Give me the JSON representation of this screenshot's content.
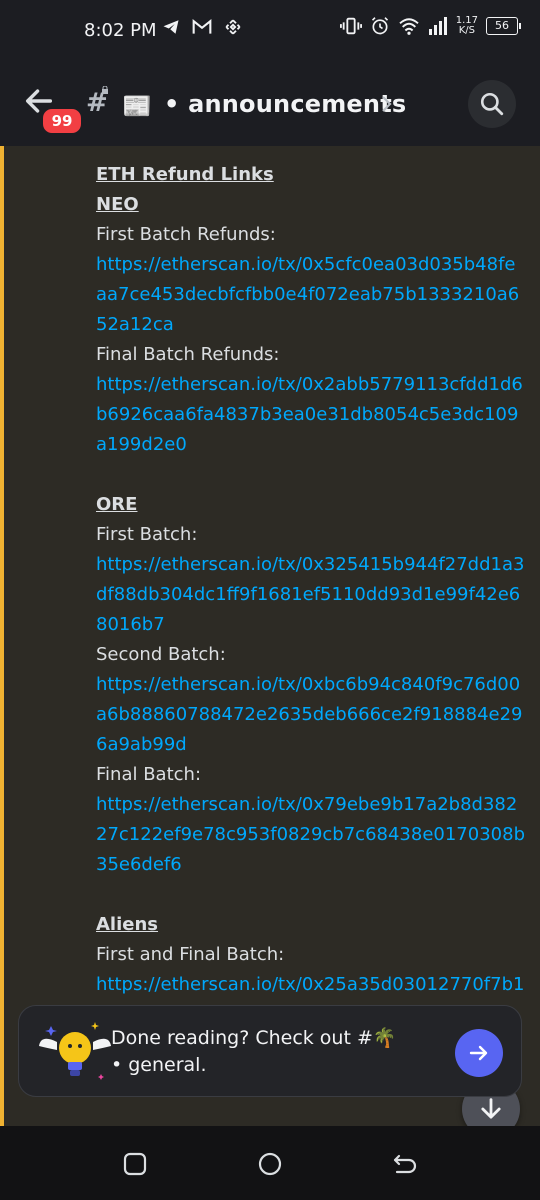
{
  "status_bar": {
    "time": "8:02 PM",
    "net_speed_value": "1.17",
    "net_speed_unit": "K/S",
    "battery": "56"
  },
  "header": {
    "unread_badge": "99",
    "channel_emoji": "📰",
    "channel_name": "• announcements"
  },
  "message": {
    "eth_heading": "ETH Refund Links",
    "neo_heading": "NEO",
    "neo_first_label": "First Batch Refunds:",
    "neo_first_link": "https://etherscan.io/tx/0x5cfc0ea03d035b48feaa7ce453decbfcfbb0e4f072eab75b1333210a652a12ca",
    "neo_final_label": "Final Batch Refunds:",
    "neo_final_link": "https://etherscan.io/tx/0x2abb5779113cfdd1d6b6926caa6fa4837b3ea0e31db8054c5e3dc109a199d2e0",
    "ore_heading": "ORE",
    "ore_first_label": "First Batch:",
    "ore_first_link": "https://etherscan.io/tx/0x325415b944f27dd1a3df88db304dc1ff9f1681ef5110dd93d1e99f42e68016b7",
    "ore_second_label": "Second Batch:",
    "ore_second_link": "https://etherscan.io/tx/0xbc6b94c840f9c76d00a6b88860788472e2635deb666ce2f918884e296a9ab99d",
    "ore_final_label": "Final Batch:",
    "ore_final_link": "https://etherscan.io/tx/0x79ebe9b17a2b8d38227c122ef9e78c953f0829cb7c68438e0170308b35e6def6",
    "aliens_heading": "Aliens",
    "aliens_label": "First and Final Batch:",
    "aliens_link": "https://etherscan.io/tx/0x25a35d03012770f7b1"
  },
  "done_card": {
    "text": "Done reading? Check out #🌴 • general."
  },
  "colors": {
    "link": "#00a8fc",
    "accent_bar": "#f0b232",
    "badge": "#f23f43",
    "go_button": "#5865f2"
  },
  "icons": [
    "back-arrow-icon",
    "hash-icon",
    "chevron-right-icon",
    "search-icon",
    "arrow-down-icon",
    "arrow-right-icon",
    "square-icon",
    "circle-icon",
    "back-icon"
  ]
}
